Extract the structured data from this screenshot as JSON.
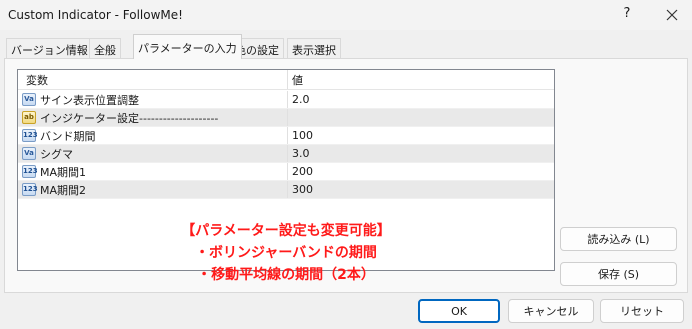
{
  "window": {
    "title": "Custom Indicator - FollowMe!",
    "help_label": "?",
    "close_icon": "close-icon"
  },
  "tabs": [
    {
      "label": "バージョン情報"
    },
    {
      "label": "全般"
    },
    {
      "label": "パラメーターの入力",
      "active": true
    },
    {
      "label": "色の設定"
    },
    {
      "label": "表示選択"
    }
  ],
  "grid": {
    "headers": {
      "name": "変数",
      "value": "値"
    },
    "rows": [
      {
        "icon": "Va",
        "icon_name": "variable-double-icon",
        "name": "サイン表示位置調整",
        "value": "2.0"
      },
      {
        "icon": "ab",
        "icon_name": "variable-string-icon",
        "name": "インジケーター設定--------------------",
        "value": ""
      },
      {
        "icon": "123",
        "icon_name": "variable-integer-icon",
        "name": "バンド期間",
        "value": "100"
      },
      {
        "icon": "Va",
        "icon_name": "variable-double-icon",
        "name": "シグマ",
        "value": "3.0"
      },
      {
        "icon": "123",
        "icon_name": "variable-integer-icon",
        "name": "MA期間1",
        "value": "200"
      },
      {
        "icon": "123",
        "icon_name": "variable-integer-icon",
        "name": "MA期間2",
        "value": "300"
      }
    ]
  },
  "annotation": {
    "line1": "【パラメーター設定も変更可能】",
    "line2": "・ボリンジャーバンドの期間",
    "line3": "・移動平均線の期間（2本）",
    "color": "#ff1a1a"
  },
  "side_buttons": {
    "load": "読み込み (L)",
    "save": "保存 (S)"
  },
  "bottom_buttons": {
    "ok": "OK",
    "cancel": "キャンセル",
    "reset": "リセット"
  },
  "colors": {
    "ok_border": "#0067c0",
    "alt_row": "#e9e9e9"
  }
}
